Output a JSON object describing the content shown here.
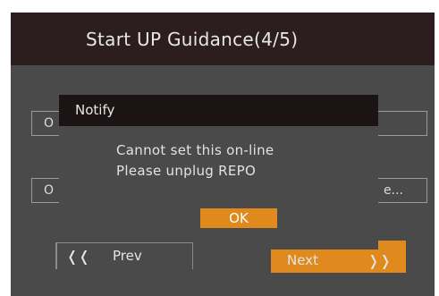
{
  "header": {
    "title": "Start UP Guidance(4/5)"
  },
  "background_fields": {
    "field1_visible_text": "O",
    "field2_left_text": "O",
    "field2_right_text": "e..."
  },
  "dialog": {
    "title": "Notify",
    "line1": "Cannot set this on-line",
    "line2": "Please unplug REPO",
    "ok_label": "OK"
  },
  "footer": {
    "prev_label": "Prev",
    "prev_icon": "double-chevron-left-icon",
    "prev_glyph": "❬❬",
    "next_label": "Next",
    "next_icon": "double-chevron-right-icon",
    "next_glyph": "❭❭"
  },
  "colors": {
    "accent": "#e08a1e",
    "screen_bg": "#4a4a4a",
    "title_bar_bg": "#2c1e1e",
    "dialog_header_bg": "#1c1414"
  }
}
